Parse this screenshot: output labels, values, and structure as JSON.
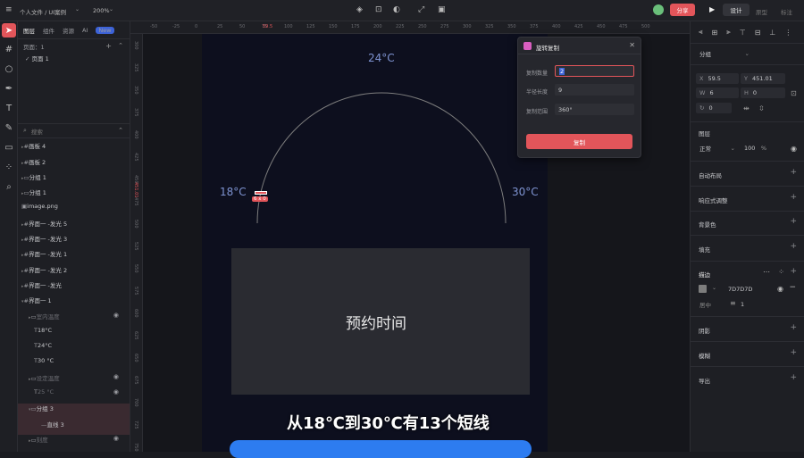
{
  "topbar": {
    "breadcrumb": "个人文件 / UI案例",
    "zoom": "200%",
    "share_label": "分享",
    "modes": [
      "设计",
      "原型",
      "标注"
    ]
  },
  "layers_panel": {
    "tabs": [
      "图层",
      "组件",
      "资源",
      "AI"
    ],
    "new_badge": "New",
    "pages_label": "页面：1",
    "page_item": "页面 1",
    "search_placeholder": "搜索",
    "items": [
      "画板 4",
      "画板 2",
      "分组 1",
      "分组 1",
      "image.png",
      "界面一 -发光 5",
      "界面一 -发光 3",
      "界面一 -发光 1",
      "界面一 -发光 2",
      "界面一 -发光",
      "界面一 1",
      "室内温度",
      "18°C",
      "24°C",
      "30 °C",
      "设定温度",
      "25 °C",
      "分组 3",
      "直线 3",
      "刻度"
    ]
  },
  "rulers": {
    "top": [
      "-50",
      "-25",
      "0",
      "25",
      "50",
      "75",
      "100",
      "125",
      "150",
      "175",
      "200",
      "225",
      "250",
      "275",
      "300",
      "325",
      "350",
      "375",
      "400",
      "425",
      "450",
      "475",
      "500"
    ],
    "top_highlight": "59.5",
    "left": [
      "300",
      "325",
      "350",
      "375",
      "400",
      "425",
      "450",
      "475",
      "500",
      "525",
      "550",
      "575",
      "600",
      "625",
      "650",
      "675",
      "700",
      "725",
      "750"
    ],
    "left_highlight": "451.01"
  },
  "canvas": {
    "temp_top": "24°C",
    "temp_left": "18°C",
    "temp_right": "30°C",
    "size_badge": "6 x 0",
    "card_text": "预约时间",
    "subtitle": "从18℃到30℃有13个短线"
  },
  "dialog": {
    "title": "旋转复制",
    "count_label": "复制数量",
    "count_value": "2",
    "radius_label": "半径长度",
    "radius_value": "9",
    "range_label": "复制范围",
    "range_value": "360°",
    "copy_button": "复制"
  },
  "props_panel": {
    "group_select": "分组",
    "x_label": "X",
    "x_value": "59.5",
    "y_label": "Y",
    "y_value": "451.01",
    "w_label": "W",
    "w_value": "6",
    "h_label": "H",
    "h_value": "0",
    "rotation_value": "0",
    "layer_section": "图层",
    "blend_mode": "正常",
    "opacity": "100",
    "opacity_unit": "%",
    "auto_layout": "自动布局",
    "responsive": "响应式调整",
    "background": "背景色",
    "fill": "填充",
    "stroke": "描边",
    "stroke_color": "7D7D7D",
    "stroke_align": "居中",
    "stroke_width": "1",
    "shadow": "阴影",
    "blur": "模糊",
    "export": "导出"
  },
  "colors": {
    "accent": "#e2555a",
    "frame_bg": "#0d0f1e",
    "temp_text": "#7e93d1"
  }
}
